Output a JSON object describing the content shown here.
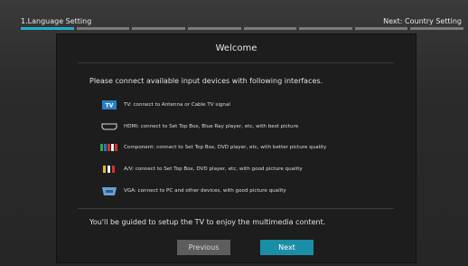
{
  "header": {
    "current_step": "1.Language Setting",
    "next_step": "Next: Country Setting",
    "progress": {
      "segments": 8,
      "active_segment": 1
    }
  },
  "dialog": {
    "title": "Welcome",
    "intro": "Please connect available input devices with following interfaces.",
    "interfaces": [
      {
        "icon": "tv-icon",
        "label": "TV: connect to Antenna or Cable TV signal"
      },
      {
        "icon": "hdmi-icon",
        "label": "HDMI: connect to Set Top Box, Blue Ray player, etc, with best picture"
      },
      {
        "icon": "component-icon",
        "label": "Component: connect to Set Top Box, DVD player, etc, with better picture quality"
      },
      {
        "icon": "av-icon",
        "label": "A/V: connect to Set Top Box, DVD player, etc, with good picture quality"
      },
      {
        "icon": "vga-icon",
        "label": "VGA: connect to PC and other devices, with good picture quality"
      }
    ],
    "footer": "You'll be guided to setup the TV to enjoy the multimedia content.",
    "previous_label": "Previous",
    "next_label": "Next"
  },
  "colors": {
    "accent": "#1fb0c8",
    "next_button": "#1a8ea6",
    "previous_button": "#5d5d5d"
  }
}
